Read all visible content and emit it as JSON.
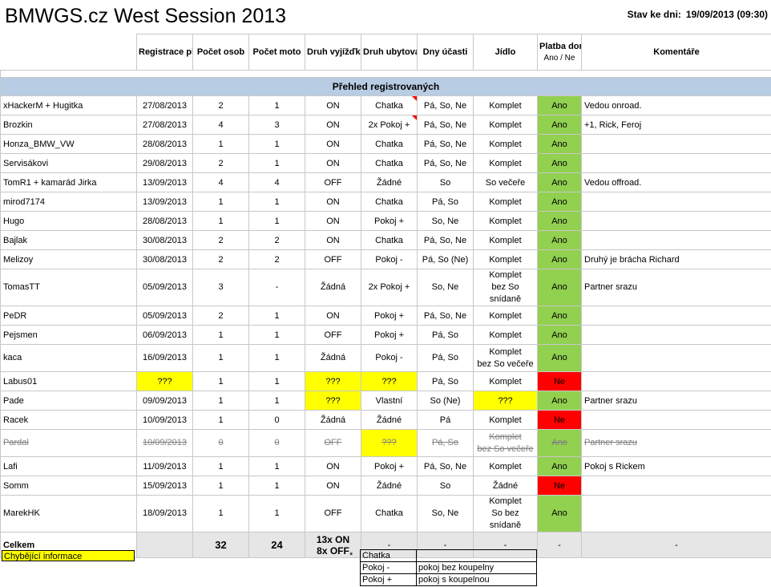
{
  "title": "BMWGS.cz West Session 2013",
  "status": {
    "label": "Stav ke dni:",
    "value": "19/09/2013 (09:30)"
  },
  "headers": {
    "registration": "Registrace přijata dne",
    "persons": "Počet osob",
    "motos": "Počet moto",
    "ride_type": "Druh vyjížďky",
    "accommodation": "Druh ubytování *",
    "days": "Dny účasti",
    "food": "Jídlo",
    "payment": "Platba dorazila",
    "payment_sub": "Ano / Ne",
    "comments": "Komentáře"
  },
  "section_title": "Přehled registrovaných",
  "rows": [
    {
      "name": "xHackerM + Hugitka",
      "date": "27/08/2013",
      "persons": "2",
      "motos": "1",
      "ride": "ON",
      "accom": "Chatka",
      "days": "Pá, So, Ne",
      "food": "Komplet",
      "paid": "Ano",
      "comment": "Vedou onroad."
    },
    {
      "name": "Brozkin",
      "date": "27/08/2013",
      "persons": "4",
      "motos": "3",
      "ride": "ON",
      "accom": "2x Pokoj +",
      "days": "Pá, So, Ne",
      "food": "Komplet",
      "paid": "Ano",
      "comment": "+1, Rick, Feroj"
    },
    {
      "name": "Honza_BMW_VW",
      "date": "28/08/2013",
      "persons": "1",
      "motos": "1",
      "ride": "ON",
      "accom": "Chatka",
      "days": "Pá, So, Ne",
      "food": "Komplet",
      "paid": "Ano",
      "comment": ""
    },
    {
      "name": "Servisákovi",
      "date": "29/08/2013",
      "persons": "2",
      "motos": "1",
      "ride": "ON",
      "accom": "Chatka",
      "days": "Pá, So, Ne",
      "food": "Komplet",
      "paid": "Ano",
      "comment": ""
    },
    {
      "name": "TomR1 + kamarád Jirka",
      "date": "13/09/2013",
      "persons": "4",
      "motos": "4",
      "ride": "OFF",
      "accom": "Žádné",
      "days": "So",
      "food": "So večeře",
      "paid": "Ano",
      "comment": "Vedou offroad."
    },
    {
      "name": "mirod7174",
      "date": "13/09/2013",
      "persons": "1",
      "motos": "1",
      "ride": "ON",
      "accom": "Chatka",
      "days": "Pá, So",
      "food": "Komplet",
      "paid": "Ano",
      "comment": ""
    },
    {
      "name": "Hugo",
      "date": "28/08/2013",
      "persons": "1",
      "motos": "1",
      "ride": "ON",
      "accom": "Pokoj +",
      "days": "So, Ne",
      "food": "Komplet",
      "paid": "Ano",
      "comment": ""
    },
    {
      "name": "Bajlak",
      "date": "30/08/2013",
      "persons": "2",
      "motos": "2",
      "ride": "ON",
      "accom": "Chatka",
      "days": "Pá, So, Ne",
      "food": "Komplet",
      "paid": "Ano",
      "comment": ""
    },
    {
      "name": "Melizoy",
      "date": "30/08/2013",
      "persons": "2",
      "motos": "2",
      "ride": "OFF",
      "accom": "Pokoj -",
      "days": "Pá, So (Ne)",
      "food": "Komplet",
      "paid": "Ano",
      "comment": "Druhý je brácha Richard"
    },
    {
      "name": "TomasTT",
      "date": "05/09/2013",
      "persons": "3",
      "motos": "-",
      "ride": "Žádná",
      "accom": "2x Pokoj +",
      "days": "So, Ne",
      "food": "Komplet\nbez So snídaně",
      "paid": "Ano",
      "comment": "Partner srazu"
    },
    {
      "name": "PeDR",
      "date": "05/09/2013",
      "persons": "2",
      "motos": "1",
      "ride": "ON",
      "accom": "Pokoj +",
      "days": "Pá, So, Ne",
      "food": "Komplet",
      "paid": "Ano",
      "comment": ""
    },
    {
      "name": "Pejsmen",
      "date": "06/09/2013",
      "persons": "1",
      "motos": "1",
      "ride": "OFF",
      "accom": "Pokoj +",
      "days": "Pá, So",
      "food": "Komplet",
      "paid": "Ano",
      "comment": ""
    },
    {
      "name": "kaca",
      "date": "16/09/2013",
      "persons": "1",
      "motos": "1",
      "ride": "Žádná",
      "accom": "Pokoj -",
      "days": "Pá, So",
      "food": "Komplet\nbez So večeře",
      "paid": "Ano",
      "comment": ""
    },
    {
      "name": "Labus01",
      "date": "???",
      "persons": "1",
      "motos": "1",
      "ride": "???",
      "accom": "???",
      "days": "Pá, So",
      "food": "Komplet",
      "paid": "Ne",
      "comment": ""
    },
    {
      "name": "Pade",
      "date": "09/09/2013",
      "persons": "1",
      "motos": "1",
      "ride": "???",
      "accom": "Vlastní",
      "days": "So (Ne)",
      "food": "???",
      "paid": "Ano",
      "comment": "Partner srazu"
    },
    {
      "name": "Racek",
      "date": "10/09/2013",
      "persons": "1",
      "motos": "0",
      "ride": "Žádná",
      "accom": "Žádné",
      "days": "Pá",
      "food": "Komplet",
      "paid": "Ne",
      "comment": ""
    },
    {
      "name": "Pardal",
      "date": "10/09/2013",
      "persons": "0",
      "motos": "0",
      "ride": "OFF",
      "accom": "???",
      "days": "Pá, So",
      "food": "Komplet\nbez So večeře",
      "paid": "Ano",
      "comment": "Partner srazu"
    },
    {
      "name": "Lafi",
      "date": "11/09/2013",
      "persons": "1",
      "motos": "1",
      "ride": "ON",
      "accom": "Pokoj +",
      "days": "Pá, So, Ne",
      "food": "Komplet",
      "paid": "Ano",
      "comment": "Pokoj s Rickem"
    },
    {
      "name": "Somm",
      "date": "15/09/2013",
      "persons": "1",
      "motos": "1",
      "ride": "ON",
      "accom": "Žádné",
      "days": "So",
      "food": "Žádné",
      "paid": "Ne",
      "comment": ""
    },
    {
      "name": "MarekHK",
      "date": "18/09/2013",
      "persons": "1",
      "motos": "1",
      "ride": "OFF",
      "accom": "Chatka",
      "days": "So, Ne",
      "food": "Komplet\nSo bez snídaně",
      "paid": "Ano",
      "comment": ""
    }
  ],
  "totals": {
    "label": "Celkem",
    "persons": "32",
    "motos": "24",
    "ride_on": "13x ON",
    "ride_off": "8x OFF",
    "accom": "-",
    "days": "-",
    "food": "-",
    "paid": "-",
    "comment": "-"
  },
  "legend": {
    "missing_info": "Chybějící informace"
  },
  "key": {
    "star": "*",
    "items": [
      {
        "code": "Chatka",
        "desc": ""
      },
      {
        "code": "Pokoj -",
        "desc": "pokoj bez koupelny"
      },
      {
        "code": "Pokoj +",
        "desc": "pokoj s koupelnou"
      }
    ]
  },
  "colors": {
    "paid_yes": "#92d050",
    "paid_no": "#ff0000",
    "missing": "#ffff00",
    "section": "#b8cce4"
  }
}
